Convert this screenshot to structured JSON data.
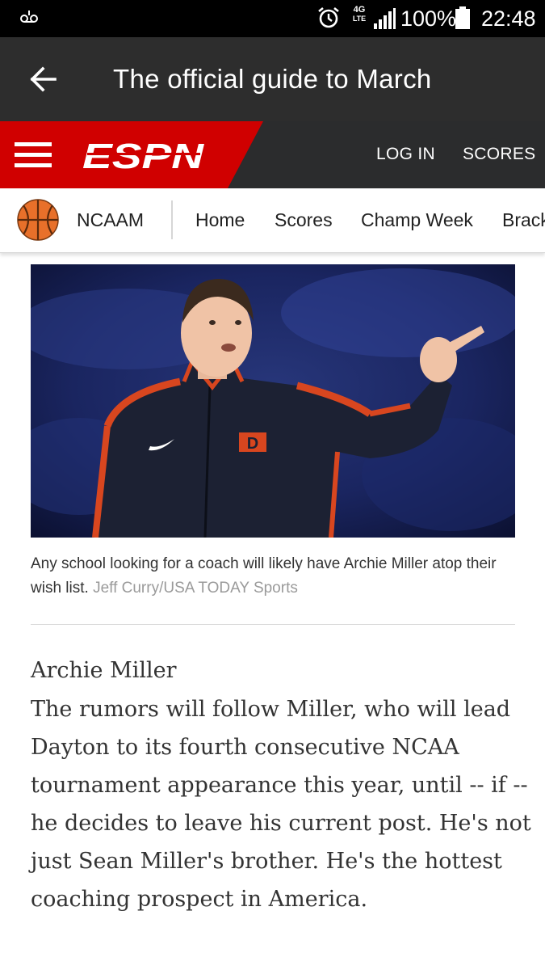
{
  "status_bar": {
    "network": "4G",
    "network_sub": "LTE",
    "battery": "100%",
    "time": "22:48",
    "icons": [
      "voicemail-icon",
      "alarm-icon",
      "signal-icon",
      "battery-icon"
    ]
  },
  "app_bar": {
    "title": "The official guide to March",
    "back_icon": "arrow-left-icon"
  },
  "espn_header": {
    "logo": "ESPN",
    "login": "LOG IN",
    "scores": "SCORES",
    "colors": {
      "brand_red": "#d00000",
      "bar_dark": "#2b2c2d"
    }
  },
  "sub_nav": {
    "league": "NCAAM",
    "items": [
      "Home",
      "Scores",
      "Champ Week",
      "Brackets"
    ]
  },
  "article": {
    "caption": "Any school looking for a coach will likely have Archie Miller atop their wish list.",
    "credit": "Jeff Curry/USA TODAY Sports",
    "heading": "Archie Miller",
    "body": "The rumors will follow Miller, who will lead Dayton to its fourth consecutive NCAA tournament appearance this year, until -- if -- he decides to leave his current post. He's not just Sean Miller's brother. He's the hottest coaching prospect in America."
  }
}
